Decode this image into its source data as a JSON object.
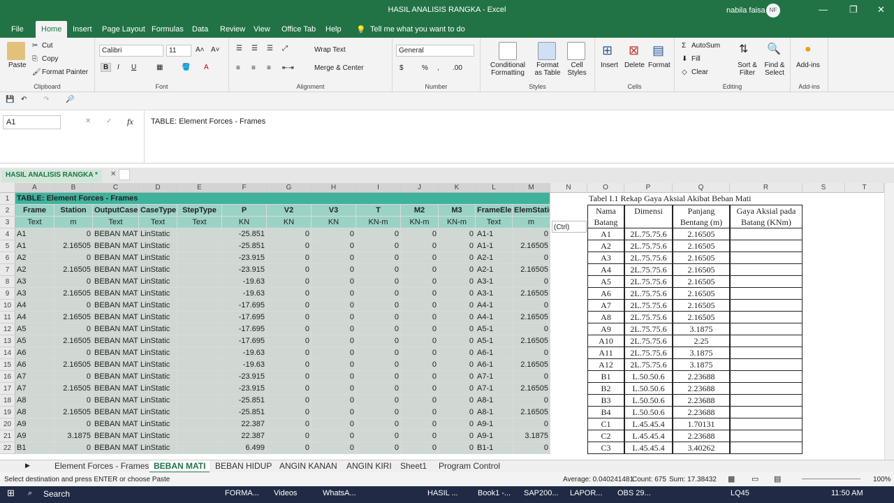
{
  "window": {
    "title": "HASIL ANALISIS RANGKA  -  Excel",
    "user": "nabila faisa",
    "avatar": "NF",
    "minimize": "—",
    "restore": "❐",
    "close": "✕"
  },
  "ribbon_tabs": [
    "File",
    "Home",
    "Insert",
    "Page Layout",
    "Formulas",
    "Data",
    "Review",
    "View",
    "Office Tab",
    "Help"
  ],
  "tell_me": "Tell me what you want to do",
  "ribbon": {
    "clipboard": {
      "paste": "Paste",
      "cut": "Cut",
      "copy": "Copy",
      "format_painter": "Format Painter",
      "label": "Clipboard"
    },
    "font": {
      "name": "Calibri",
      "size": "11",
      "label": "Font"
    },
    "alignment": {
      "wrap": "Wrap Text",
      "merge": "Merge & Center",
      "label": "Alignment"
    },
    "number": {
      "format": "General",
      "label": "Number"
    },
    "styles": {
      "conditional": "Conditional Formatting",
      "format_table": "Format as Table",
      "cell_styles": "Cell Styles",
      "label": "Styles"
    },
    "cells": {
      "insert": "Insert",
      "delete": "Delete",
      "format": "Format",
      "label": "Cells"
    },
    "editing": {
      "autosum": "AutoSum",
      "fill": "Fill",
      "clear": "Clear",
      "sort": "Sort & Filter",
      "find": "Find & Select",
      "label": "Editing"
    },
    "addins": {
      "addins": "Add-ins",
      "label": "Add-ins"
    }
  },
  "formula_bar": {
    "name_box": "A1",
    "fx": "fx",
    "content": "TABLE:  Element Forces - Frames"
  },
  "doc_tab": "HASIL ANALISIS RANGKA *",
  "columns": [
    "A",
    "B",
    "C",
    "D",
    "E",
    "F",
    "G",
    "H",
    "I",
    "J",
    "K",
    "L",
    "M",
    "N",
    "O",
    "P",
    "Q",
    "R",
    "S",
    "T"
  ],
  "left_table": {
    "title": "TABLE:  Element Forces - Frames",
    "headers": [
      "Frame",
      "Station",
      "OutputCase",
      "CaseType",
      "StepType",
      "P",
      "V2",
      "V3",
      "T",
      "M2",
      "M3",
      "FrameElem",
      "ElemStation"
    ],
    "units": [
      "Text",
      "m",
      "Text",
      "Text",
      "Text",
      "KN",
      "KN",
      "KN",
      "KN-m",
      "KN-m",
      "KN-m",
      "Text",
      "m"
    ],
    "rows": [
      [
        "A1",
        "0",
        "BEBAN MATI",
        "LinStatic",
        "",
        "-25.851",
        "0",
        "0",
        "0",
        "0",
        "0",
        "A1-1",
        "0"
      ],
      [
        "A1",
        "2.16505",
        "BEBAN MATI",
        "LinStatic",
        "",
        "-25.851",
        "0",
        "0",
        "0",
        "0",
        "0",
        "A1-1",
        "2.16505"
      ],
      [
        "A2",
        "0",
        "BEBAN MATI",
        "LinStatic",
        "",
        "-23.915",
        "0",
        "0",
        "0",
        "0",
        "0",
        "A2-1",
        "0"
      ],
      [
        "A2",
        "2.16505",
        "BEBAN MATI",
        "LinStatic",
        "",
        "-23.915",
        "0",
        "0",
        "0",
        "0",
        "0",
        "A2-1",
        "2.16505"
      ],
      [
        "A3",
        "0",
        "BEBAN MATI",
        "LinStatic",
        "",
        "-19.63",
        "0",
        "0",
        "0",
        "0",
        "0",
        "A3-1",
        "0"
      ],
      [
        "A3",
        "2.16505",
        "BEBAN MATI",
        "LinStatic",
        "",
        "-19.63",
        "0",
        "0",
        "0",
        "0",
        "0",
        "A3-1",
        "2.16505"
      ],
      [
        "A4",
        "0",
        "BEBAN MATI",
        "LinStatic",
        "",
        "-17.695",
        "0",
        "0",
        "0",
        "0",
        "0",
        "A4-1",
        "0"
      ],
      [
        "A4",
        "2.16505",
        "BEBAN MATI",
        "LinStatic",
        "",
        "-17.695",
        "0",
        "0",
        "0",
        "0",
        "0",
        "A4-1",
        "2.16505"
      ],
      [
        "A5",
        "0",
        "BEBAN MATI",
        "LinStatic",
        "",
        "-17.695",
        "0",
        "0",
        "0",
        "0",
        "0",
        "A5-1",
        "0"
      ],
      [
        "A5",
        "2.16505",
        "BEBAN MATI",
        "LinStatic",
        "",
        "-17.695",
        "0",
        "0",
        "0",
        "0",
        "0",
        "A5-1",
        "2.16505"
      ],
      [
        "A6",
        "0",
        "BEBAN MATI",
        "LinStatic",
        "",
        "-19.63",
        "0",
        "0",
        "0",
        "0",
        "0",
        "A6-1",
        "0"
      ],
      [
        "A6",
        "2.16505",
        "BEBAN MATI",
        "LinStatic",
        "",
        "-19.63",
        "0",
        "0",
        "0",
        "0",
        "0",
        "A6-1",
        "2.16505"
      ],
      [
        "A7",
        "0",
        "BEBAN MATI",
        "LinStatic",
        "",
        "-23.915",
        "0",
        "0",
        "0",
        "0",
        "0",
        "A7-1",
        "0"
      ],
      [
        "A7",
        "2.16505",
        "BEBAN MATI",
        "LinStatic",
        "",
        "-23.915",
        "0",
        "0",
        "0",
        "0",
        "0",
        "A7-1",
        "2.16505"
      ],
      [
        "A8",
        "0",
        "BEBAN MATI",
        "LinStatic",
        "",
        "-25.851",
        "0",
        "0",
        "0",
        "0",
        "0",
        "A8-1",
        "0"
      ],
      [
        "A8",
        "2.16505",
        "BEBAN MATI",
        "LinStatic",
        "",
        "-25.851",
        "0",
        "0",
        "0",
        "0",
        "0",
        "A8-1",
        "2.16505"
      ],
      [
        "A9",
        "0",
        "BEBAN MATI",
        "LinStatic",
        "",
        "22.387",
        "0",
        "0",
        "0",
        "0",
        "0",
        "A9-1",
        "0"
      ],
      [
        "A9",
        "3.1875",
        "BEBAN MATI",
        "LinStatic",
        "",
        "22.387",
        "0",
        "0",
        "0",
        "0",
        "0",
        "A9-1",
        "3.1875"
      ],
      [
        "B1",
        "0",
        "BEBAN MATI",
        "LinStatic",
        "",
        "6.499",
        "0",
        "0",
        "0",
        "0",
        "0",
        "B1-1",
        "0"
      ]
    ]
  },
  "right_table": {
    "title": "Tabel I.1  Rekap Gaya Aksial Akibat Beban Mati",
    "headers": [
      "Nama Batang",
      "Dimensi",
      "Panjang Bentang (m)",
      "Gaya Aksial pada Batang (KNm)"
    ],
    "rows": [
      [
        "A1",
        "2L.75.75.6",
        "2.16505",
        ""
      ],
      [
        "A2",
        "2L.75.75.6",
        "2.16505",
        ""
      ],
      [
        "A3",
        "2L.75.75.6",
        "2.16505",
        ""
      ],
      [
        "A4",
        "2L.75.75.6",
        "2.16505",
        ""
      ],
      [
        "A5",
        "2L.75.75.6",
        "2.16505",
        ""
      ],
      [
        "A6",
        "2L.75.75.6",
        "2.16505",
        ""
      ],
      [
        "A7",
        "2L.75.75.6",
        "2.16505",
        ""
      ],
      [
        "A8",
        "2L.75.75.6",
        "2.16505",
        ""
      ],
      [
        "A9",
        "2L.75.75.6",
        "3.1875",
        ""
      ],
      [
        "A10",
        "2L.75.75.6",
        "2.25",
        ""
      ],
      [
        "A11",
        "2L.75.75.6",
        "3.1875",
        ""
      ],
      [
        "A12",
        "2L.75.75.6",
        "3.1875",
        ""
      ],
      [
        "B1",
        "L.50.50.6",
        "2.23688",
        ""
      ],
      [
        "B2",
        "L.50.50.6",
        "2.23688",
        ""
      ],
      [
        "B3",
        "L.50.50.6",
        "2.23688",
        ""
      ],
      [
        "B4",
        "L.50.50.6",
        "2.23688",
        ""
      ],
      [
        "C1",
        "L.45.45.4",
        "1.70131",
        ""
      ],
      [
        "C2",
        "L.45.45.4",
        "2.23688",
        ""
      ],
      [
        "C3",
        "L.45.45.4",
        "3.40262",
        ""
      ]
    ]
  },
  "paste_ctrl": "(Ctrl)",
  "sheets": [
    "Element Forces - Frames",
    "BEBAN MATI",
    "BEBAN HIDUP",
    "ANGIN KANAN",
    "ANGIN KIRI",
    "Sheet1",
    "Program Control"
  ],
  "active_sheet": "BEBAN MATI",
  "status": {
    "message": "Select destination and press ENTER or choose Paste",
    "average": "Average: 0.040241481",
    "count": "Count: 675",
    "sum": "Sum: 17.38432",
    "zoom": "100%"
  },
  "taskbar": {
    "search": "Search",
    "items": [
      "FORMA...",
      "Videos",
      "WhatsA...",
      "HASIL ...",
      "Book1 -...",
      "SAP200...",
      "LAPOR...",
      "OBS 29..."
    ],
    "tray": "LQ45",
    "time": "11:50 AM"
  },
  "colors": {
    "excel_green": "#217346",
    "header_fill": "#9ad3c6",
    "title_fill": "#3fb29c",
    "task": "#202a44"
  }
}
